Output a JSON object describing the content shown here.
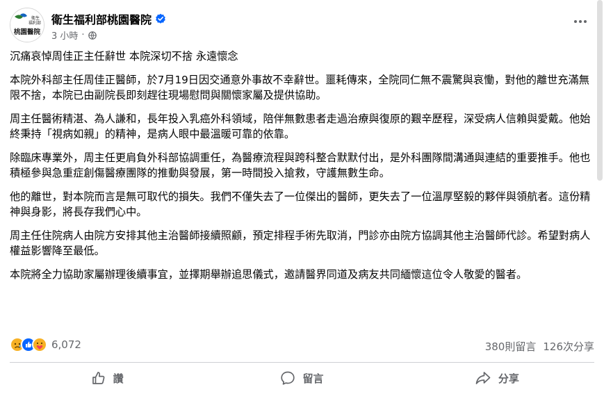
{
  "post": {
    "page_name": "衛生福利部桃園醫院",
    "timestamp": "3 小時",
    "separator": "·",
    "avatar_text_line1": "衛生",
    "avatar_text_line2": "福利部",
    "avatar_text_line3": "桃園醫院",
    "headline": "沉痛哀悼周佳正主任辭世 本院深切不捨 永遠懷念",
    "paragraphs": [
      "本院外科部主任周佳正醫師，於7月19日因交通意外事故不幸辭世。噩耗傳來，全院同仁無不震驚與哀慟，對他的離世充滿無限不捨，本院已由副院長即刻趕往現場慰問與關懷家屬及提供協助。",
      "周主任醫術精湛、為人謙和，長年投入乳癌外科領域，陪伴無數患者走過治療與復原的艱辛歷程，深受病人信賴與愛戴。他始終秉持「視病如親」的精神，是病人眼中最溫暖可靠的依靠。",
      "除臨床專業外，周主任更肩負外科部協調重任，為醫療流程與跨科整合默默付出，是外科團隊間溝通與連結的重要推手。他也積極參與急重症創傷醫療團隊的推動與發展，第一時間投入搶救，守護無數生命。",
      "他的離世，對本院而言是無可取代的損失。我們不僅失去了一位傑出的醫師，更失去了一位溫厚堅毅的夥伴與領航者。這份精神與身影，將長存我們心中。",
      "周主任住院病人由院方安排其他主治醫師接續照顧，預定排程手術先取消，門診亦由院方協調其他主治醫師代診。希望對病人權益影響降至最低。",
      "本院將全力協助家屬辦理後續事宜，並擇期舉辦追思儀式，邀請醫界同道及病友共同緬懷這位令人敬愛的醫者。"
    ]
  },
  "stats": {
    "reaction_count": "6,072",
    "comments": "380則留言",
    "shares": "126次分享",
    "reaction_icons": [
      "sad-icon",
      "like-icon",
      "care-icon"
    ]
  },
  "actions": {
    "like_label": "讚",
    "comment_label": "留言",
    "share_label": "分享"
  },
  "colors": {
    "primary_text": "#050505",
    "secondary_text": "#65676b",
    "verified_blue": "#0866ff",
    "divider": "#ced0d4"
  }
}
